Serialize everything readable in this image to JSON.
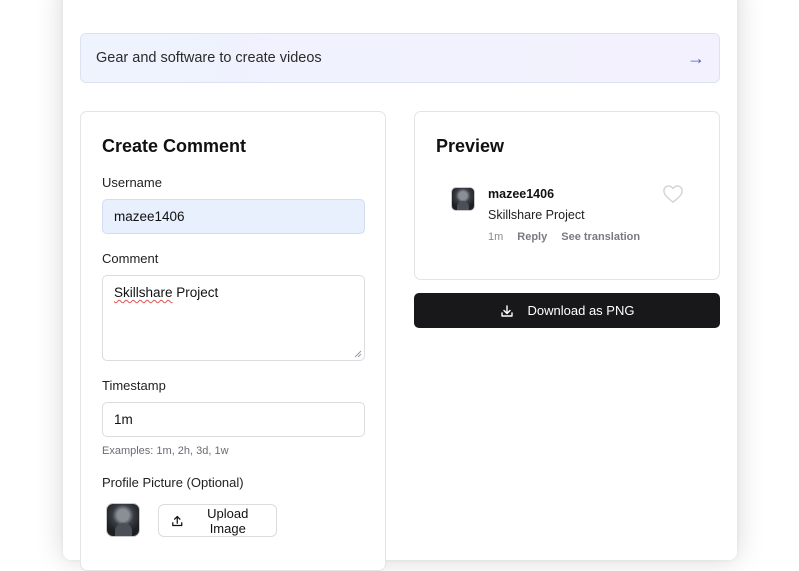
{
  "banner": {
    "text": "Gear and software to create videos",
    "arrow": "→"
  },
  "create": {
    "title": "Create Comment",
    "username_label": "Username",
    "username_value": "mazee1406",
    "comment_label": "Comment",
    "comment_value_word1": "Skillshare",
    "comment_value_rest": " Project",
    "timestamp_label": "Timestamp",
    "timestamp_value": "1m",
    "timestamp_hint": "Examples: 1m, 2h, 3d, 1w",
    "profile_label": "Profile Picture (Optional)",
    "upload_label": "Upload Image"
  },
  "preview": {
    "title": "Preview",
    "username": "mazee1406",
    "comment": "Skillshare Project",
    "time": "1m",
    "reply": "Reply",
    "translate": "See translation"
  },
  "download": {
    "label": "Download as PNG"
  },
  "icons": {
    "banner_arrow": "arrow-right-icon",
    "upload": "upload-icon",
    "download": "download-icon",
    "like": "heart-icon"
  },
  "colors": {
    "accent": "#3a63e0",
    "dark_button": "#18181b",
    "username_fill": "#e8effd"
  }
}
